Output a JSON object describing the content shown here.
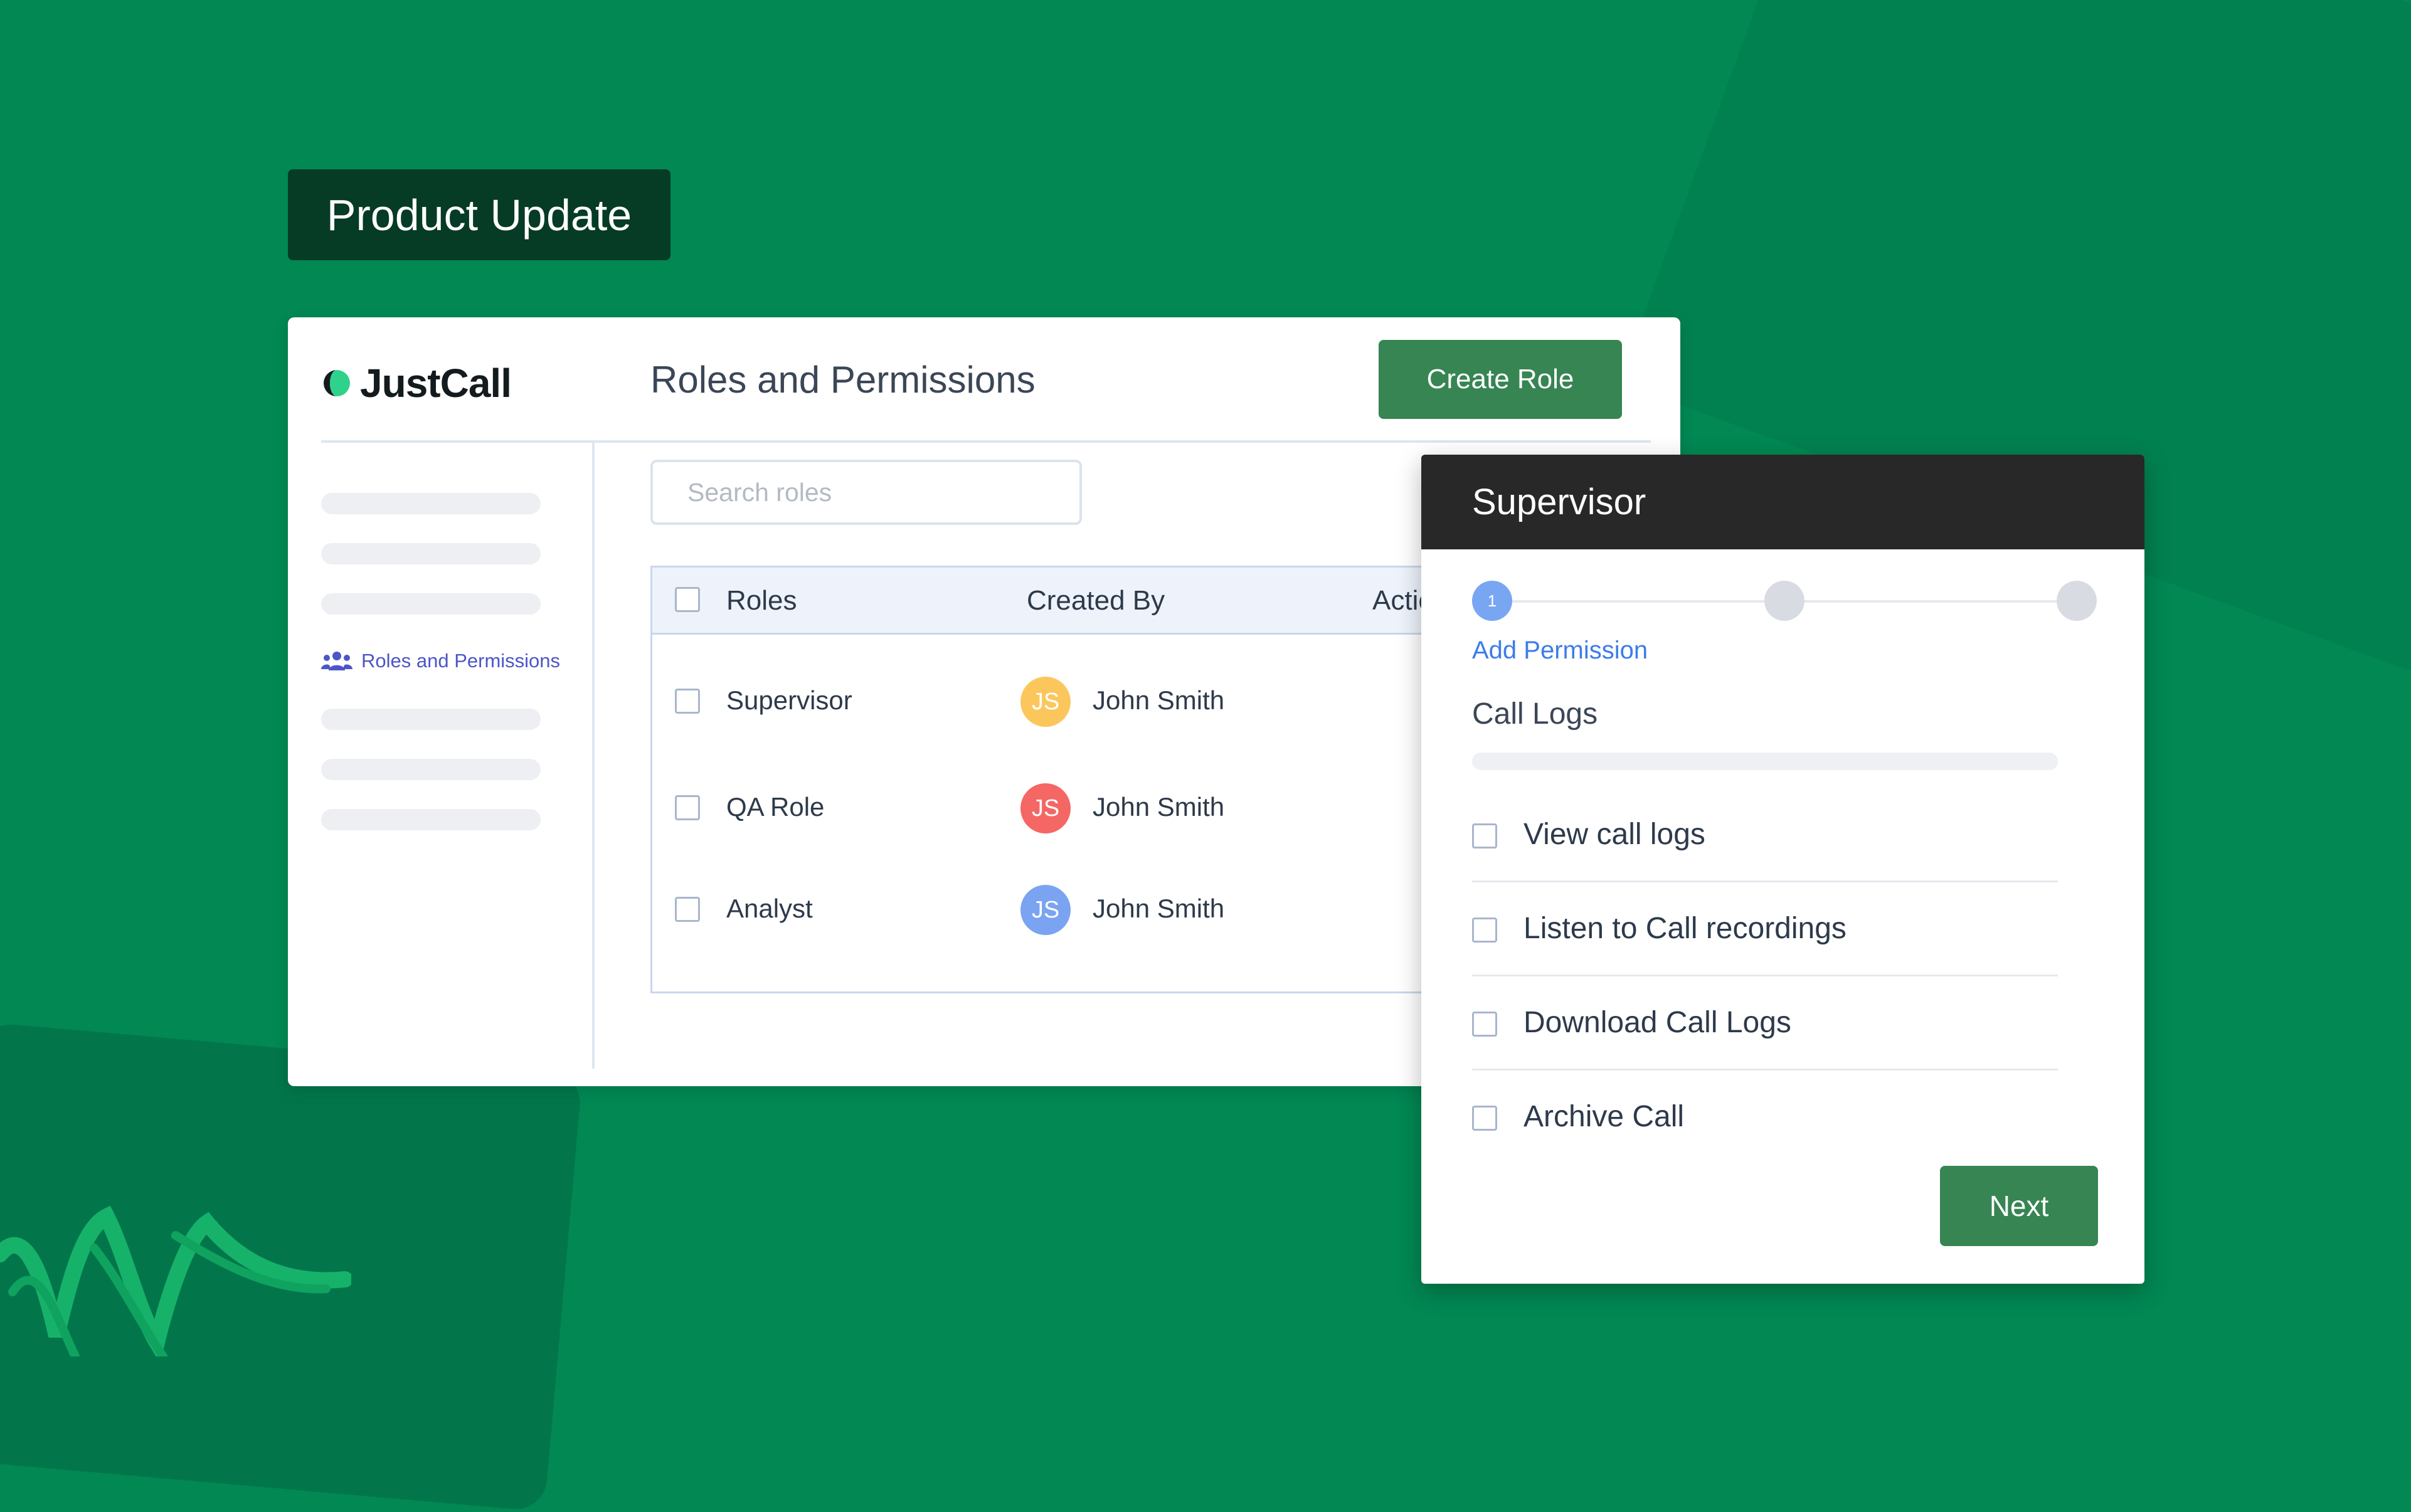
{
  "badge": {
    "label": "Product Update"
  },
  "app": {
    "logo_text": "JustCall"
  },
  "header": {
    "title": "Roles and Permissions",
    "create_label": "Create Role"
  },
  "sidebar": {
    "active_label": "Roles and Permissions",
    "active_icon": "users-icon"
  },
  "search": {
    "placeholder": "Search roles"
  },
  "table": {
    "headers": {
      "roles": "Roles",
      "created_by": "Created By",
      "actions": "Actions"
    },
    "rows": [
      {
        "role": "Supervisor",
        "initials": "JS",
        "creator": "John Smith",
        "avatar_color": "#fbc75d"
      },
      {
        "role": "QA Role",
        "initials": "JS",
        "creator": "John Smith",
        "avatar_color": "#f46764"
      },
      {
        "role": "Analyst",
        "initials": "JS",
        "creator": "John Smith",
        "avatar_color": "#7aa4f2"
      }
    ]
  },
  "panel": {
    "title": "Supervisor",
    "steps": {
      "current": "1",
      "total": 3
    },
    "step_label": "Add Permission",
    "section": "Call Logs",
    "permissions": [
      "View call logs",
      "Listen to Call recordings",
      "Download Call Logs",
      "Archive Call"
    ],
    "next_label": "Next"
  },
  "colors": {
    "background": "#018853",
    "button": "#368552",
    "badge": "#063b25",
    "panel_header": "#282828",
    "accent_blue": "#3d7cea",
    "sidebar_active": "#4c56c8"
  }
}
